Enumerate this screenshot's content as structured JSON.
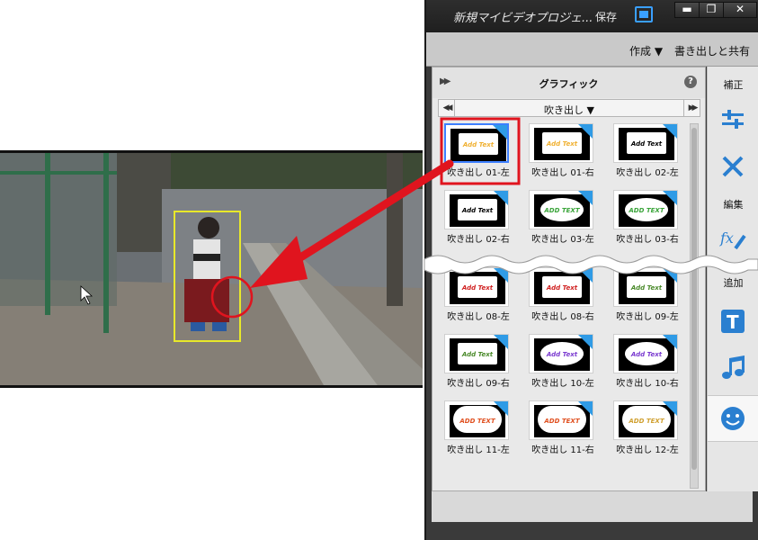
{
  "app": {
    "title": "新規マイビデオプロジェ...",
    "save_label": "保存",
    "create_label": "作成 ▼",
    "export_label": "書き出しと共有",
    "window_buttons": [
      "▬",
      "❐",
      "✕"
    ]
  },
  "panel": {
    "title": "グラフィック",
    "category": "吹き出し ▼",
    "help": "?"
  },
  "sidebar": {
    "correct_label": "補正",
    "edit_label": "編集",
    "add_label": "追加",
    "icons": [
      "adjust-sliders-icon",
      "tools-icon",
      "fx-icon",
      "title-icon",
      "music-icon",
      "sticker-icon"
    ]
  },
  "tiles": [
    {
      "label": "吹き出し 01-左",
      "text": "Add Text",
      "text_color": "#f0b030",
      "bubble": "rect",
      "selected": true
    },
    {
      "label": "吹き出し 01-右",
      "text": "Add Text",
      "text_color": "#f0b030",
      "bubble": "rect"
    },
    {
      "label": "吹き出し 02-左",
      "text": "Add Text",
      "text_color": "#000000",
      "bubble": "rect"
    },
    {
      "label": "吹き出し 02-右",
      "text": "Add Text",
      "text_color": "#000000",
      "bubble": "rect"
    },
    {
      "label": "吹き出し 03-左",
      "text": "ADD TEXT",
      "text_color": "#3aa43a",
      "bubble": "oval"
    },
    {
      "label": "吹き出し 03-右",
      "text": "ADD TEXT",
      "text_color": "#3aa43a",
      "bubble": "oval"
    },
    {
      "label": "吹き出し 08-左",
      "text": "Add Text",
      "text_color": "#d02020",
      "bubble": "rect"
    },
    {
      "label": "吹き出し 08-右",
      "text": "Add Text",
      "text_color": "#d02020",
      "bubble": "rect"
    },
    {
      "label": "吹き出し 09-左",
      "text": "Add Text",
      "text_color": "#4a8a2a",
      "bubble": "rect"
    },
    {
      "label": "吹き出し 09-右",
      "text": "Add Text",
      "text_color": "#4a8a2a",
      "bubble": "rect"
    },
    {
      "label": "吹き出し 10-左",
      "text": "Add Text",
      "text_color": "#7a3ad0",
      "bubble": "oval"
    },
    {
      "label": "吹き出し 10-右",
      "text": "Add Text",
      "text_color": "#7a3ad0",
      "bubble": "oval"
    },
    {
      "label": "吹き出し 11-左",
      "text": "ADD TEXT",
      "text_color": "#e05020",
      "bubble": "cloud"
    },
    {
      "label": "吹き出し 11-右",
      "text": "ADD TEXT",
      "text_color": "#e05020",
      "bubble": "cloud"
    },
    {
      "label": "吹き出し 12-左",
      "text": "ADD TEXT",
      "text_color": "#d0a030",
      "bubble": "cloud"
    }
  ],
  "colors": {
    "highlight_red": "#e0141e",
    "tracking_box": "#e8e82a",
    "accent_blue": "#2f9be6"
  }
}
